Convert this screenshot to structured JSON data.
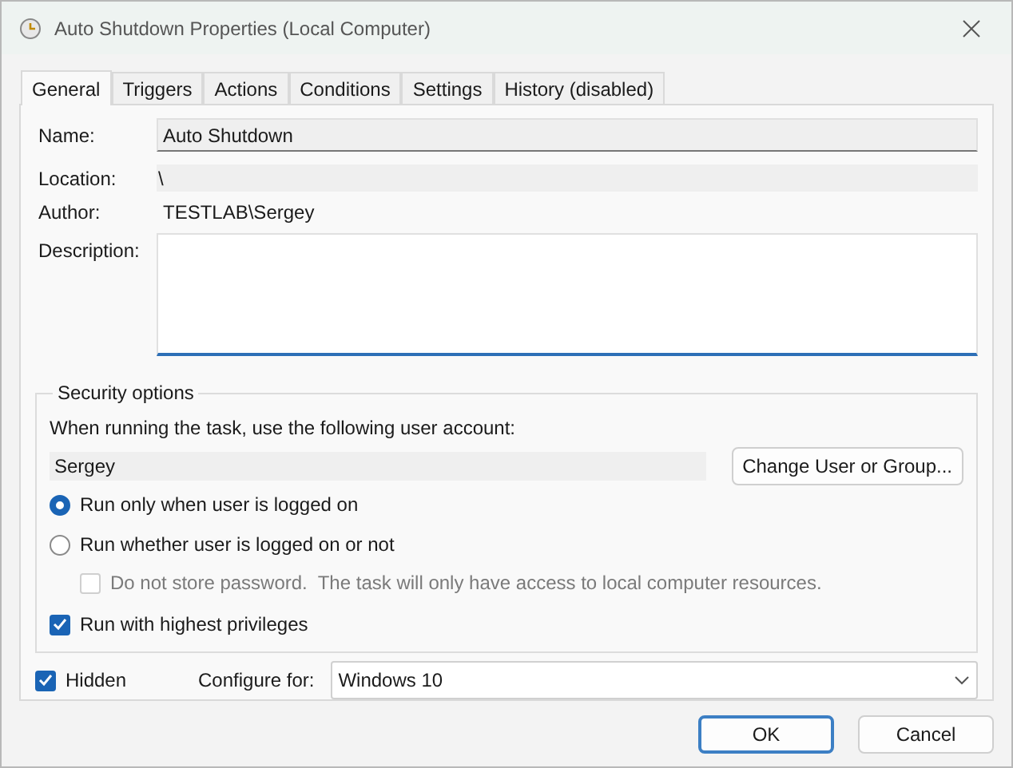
{
  "window": {
    "title": "Auto Shutdown Properties (Local Computer)"
  },
  "tabs": [
    {
      "label": "General",
      "selected": true
    },
    {
      "label": "Triggers",
      "selected": false
    },
    {
      "label": "Actions",
      "selected": false
    },
    {
      "label": "Conditions",
      "selected": false
    },
    {
      "label": "Settings",
      "selected": false
    },
    {
      "label": "History (disabled)",
      "selected": false
    }
  ],
  "general": {
    "name": {
      "label": "Name:",
      "value": "Auto Shutdown"
    },
    "location": {
      "label": "Location:",
      "value": "\\"
    },
    "author": {
      "label": "Author:",
      "value": "TESTLAB\\Sergey"
    },
    "description": {
      "label": "Description:"
    }
  },
  "security": {
    "legend": "Security options",
    "prompt": "When running the task, use the following user account:",
    "account": "Sergey",
    "change_button": "Change User or Group...",
    "logon_options": [
      {
        "label": "Run only when user is logged on",
        "selected": true
      },
      {
        "label": "Run whether user is logged on or not",
        "selected": false
      }
    ],
    "no_store_password": {
      "label": "Do not store password.  The task will only have access to local computer resources.",
      "checked": false,
      "disabled": true
    },
    "highest_privileges": {
      "label": "Run with highest privileges",
      "checked": true
    }
  },
  "hidden": {
    "label": "Hidden",
    "checked": true
  },
  "configure_for": {
    "label": "Configure for:",
    "value": "Windows 10"
  },
  "buttons": [
    {
      "label": "OK",
      "default": true
    },
    {
      "label": "Cancel",
      "default": false
    }
  ]
}
